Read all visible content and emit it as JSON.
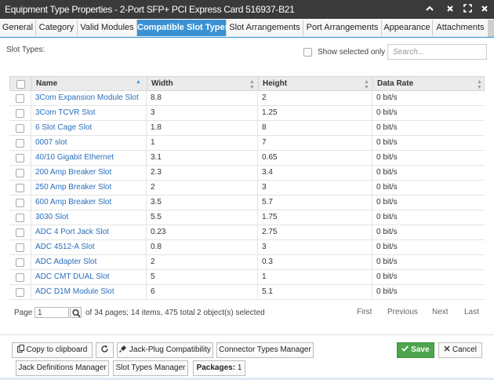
{
  "window": {
    "title": "Equipment Type Properties - 2-Port SFP+ PCI Express Card 516937-B21"
  },
  "tabs": [
    {
      "label": "General",
      "active": false
    },
    {
      "label": "Category",
      "active": false
    },
    {
      "label": "Valid Modules",
      "active": false
    },
    {
      "label": "Compatible Slot Types",
      "active": true
    },
    {
      "label": "Slot Arrangements",
      "active": false
    },
    {
      "label": "Port Arrangements",
      "active": false
    },
    {
      "label": "Appearance",
      "active": false
    },
    {
      "label": "Attachments",
      "active": false
    }
  ],
  "panel": {
    "section_label": "Slot Types:",
    "show_selected_label": "Show selected only",
    "search_placeholder": "Search..."
  },
  "grid": {
    "columns": [
      "Name",
      "Width",
      "Height",
      "Data Rate"
    ],
    "rows": [
      {
        "name": "3Com Expansion Module Slot",
        "width": "8.8",
        "height": "2",
        "rate": "0 bit/s"
      },
      {
        "name": "3Com TCVR Slot",
        "width": "3",
        "height": "1.25",
        "rate": "0 bit/s"
      },
      {
        "name": "6 Slot Cage Slot",
        "width": "1.8",
        "height": "8",
        "rate": "0 bit/s"
      },
      {
        "name": "0007 slot",
        "width": "1",
        "height": "7",
        "rate": "0 bit/s"
      },
      {
        "name": "40/10 Gigabit Ethernet",
        "width": "3.1",
        "height": "0.65",
        "rate": "0 bit/s"
      },
      {
        "name": "200 Amp Breaker Slot",
        "width": "2.3",
        "height": "3.4",
        "rate": "0 bit/s"
      },
      {
        "name": "250 Amp Breaker Slot",
        "width": "2",
        "height": "3",
        "rate": "0 bit/s"
      },
      {
        "name": "600 Amp Breaker Slot",
        "width": "3.5",
        "height": "5.7",
        "rate": "0 bit/s"
      },
      {
        "name": "3030 Slot",
        "width": "5.5",
        "height": "1.75",
        "rate": "0 bit/s"
      },
      {
        "name": "ADC 4 Port Jack Slot",
        "width": "0.23",
        "height": "2.75",
        "rate": "0 bit/s"
      },
      {
        "name": "ADC 4512-A Slot",
        "width": "0.8",
        "height": "3",
        "rate": "0 bit/s"
      },
      {
        "name": "ADC Adapter Slot",
        "width": "2",
        "height": "0.3",
        "rate": "0 bit/s"
      },
      {
        "name": "ADC CMT DUAL Slot",
        "width": "5",
        "height": "1",
        "rate": "0 bit/s"
      },
      {
        "name": "ADC D1M Module Slot",
        "width": "6",
        "height": "5.1",
        "rate": "0 bit/s"
      }
    ]
  },
  "pager": {
    "page_label": "Page",
    "page_value": "1",
    "summary": "of 34 pages; 14 items, 475 total",
    "selected": "2 object(s) selected",
    "first": "First",
    "previous": "Previous",
    "next": "Next",
    "last": "Last"
  },
  "buttons": {
    "copy": "Copy to clipboard",
    "jack_plug": "Jack-Plug Compatibility",
    "connector_types": "Connector Types Manager",
    "save": "Save",
    "cancel": "Cancel",
    "jack_definitions": "Jack Definitions Manager",
    "slot_types": "Slot Types Manager",
    "packages_label": "Packages:",
    "packages_count": "1"
  },
  "icons": {
    "collapse": "chevron-up-icon",
    "close": "close-icon",
    "maximize": "maximize-icon",
    "help": "help-icon",
    "copy": "copy-icon",
    "refresh": "refresh-icon",
    "jack_plug": "plug-icon",
    "save": "checkmark-icon",
    "cancel": "x-icon",
    "search_go": "search-icon"
  },
  "colors": {
    "titlebar": "#3a3a3a",
    "tab_active": "#3a92d4",
    "link": "#2a6ebb",
    "save": "#4ea54e"
  }
}
